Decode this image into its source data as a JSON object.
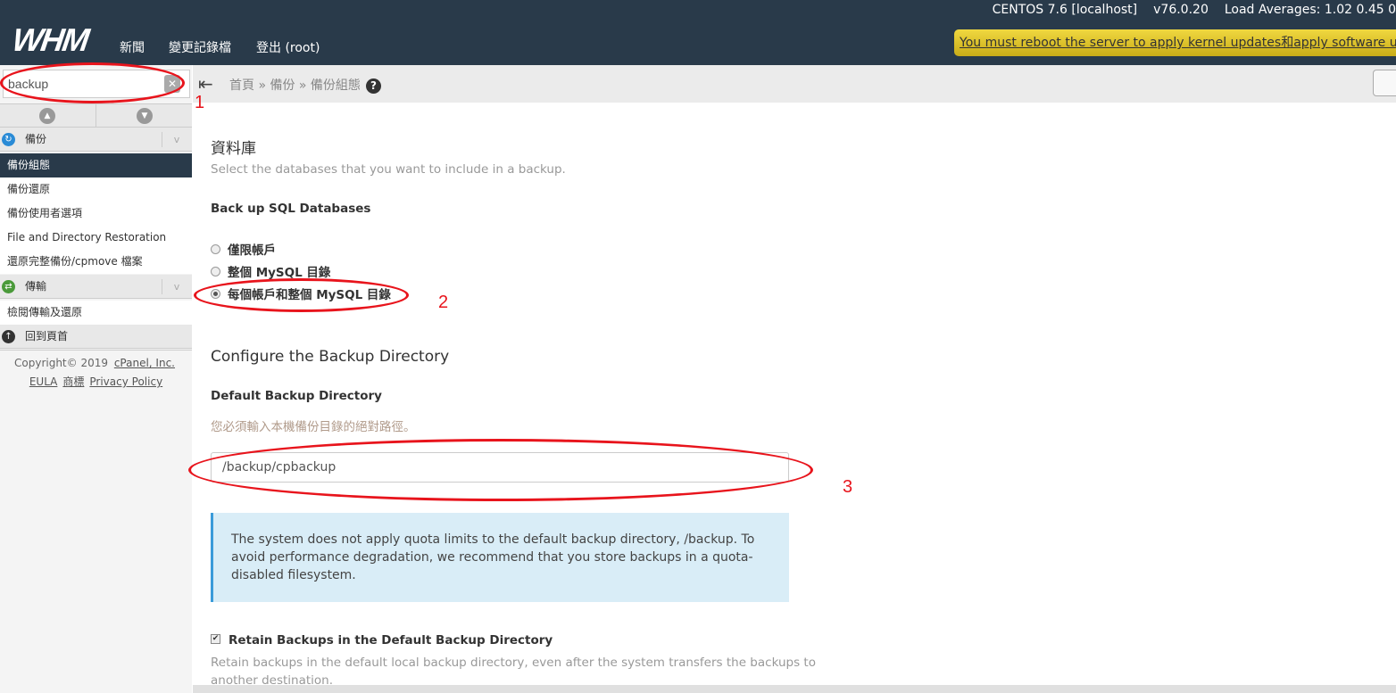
{
  "header": {
    "logo": "WHM",
    "nav": [
      "新聞",
      "變更記錄檔",
      "登出 (root)"
    ],
    "os": "CENTOS 7.6 [localhost]",
    "version": "v76.0.20",
    "load": "Load Averages: 1.02 0.45 0",
    "alert": "You must reboot the server to apply kernel updates和apply software updat"
  },
  "sidebar": {
    "search_value": "backup",
    "groups": [
      {
        "label": "備份",
        "icon": "backup-icon",
        "items": [
          "備份組態",
          "備份還原",
          "備份使用者選項",
          "File and Directory Restoration",
          "還原完整備份/cpmove 檔案"
        ]
      },
      {
        "label": "傳輸",
        "icon": "transfer-icon",
        "items": [
          "檢閱傳輸及還原"
        ]
      }
    ],
    "back_to_top": "回到頁首",
    "copyright": "Copyright© 2019",
    "cpanel": "cPanel, Inc.",
    "links": [
      "EULA",
      "商標",
      "Privacy Policy"
    ]
  },
  "breadcrumb": {
    "items": "首頁 » 備份 » 備份組態"
  },
  "main": {
    "db_title": "資料庫",
    "db_desc": "Select the databases that you want to include in a backup.",
    "sql_label": "Back up SQL Databases",
    "sql_options": [
      "僅限帳戶",
      "整個 MySQL 目錄",
      "每個帳戶和整個 MySQL 目錄"
    ],
    "sql_selected": 2,
    "dir_title": "Configure the Backup Directory",
    "dir_label": "Default Backup Directory",
    "dir_help": "您必須輸入本機備份目錄的絕對路徑。",
    "dir_value": "/backup/cpbackup",
    "info": "The system does not apply quota limits to the default backup directory, /backup. To avoid performance degradation, we recommend that you store backups in a quota-disabled filesystem.",
    "retain_label": "Retain Backups in the Default Backup Directory",
    "retain_checked": true,
    "retain_desc1": "Retain backups in the default local backup directory, even after the system transfers the backups to",
    "retain_desc2": "another destination."
  },
  "annotations": [
    "1",
    "2",
    "3"
  ],
  "colors": {
    "header": "#293a4a",
    "annotation": "#e8141c",
    "info_bg": "#d9edf7",
    "alert": "#e0c42c"
  }
}
